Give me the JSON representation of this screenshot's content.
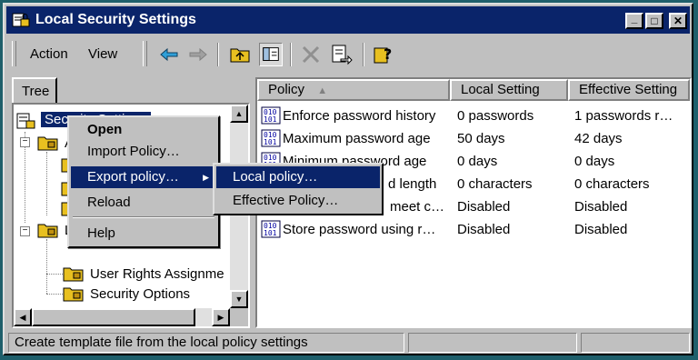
{
  "window": {
    "title": "Local Security Settings"
  },
  "caption_buttons": {
    "minimize": "_",
    "maximize": "□",
    "close": "✕"
  },
  "menu": {
    "action": "Action",
    "view": "View"
  },
  "tree": {
    "tab_label": "Tree",
    "root": "Security Settings",
    "items": [
      "A",
      "L",
      "User Rights Assignme",
      "Security Options"
    ]
  },
  "list": {
    "columns": [
      "Policy",
      "Local Setting",
      "Effective Setting"
    ],
    "sort_indicator": "▲",
    "rows": [
      {
        "policy": "Enforce password history",
        "local": "0 passwords",
        "effective": "1 passwords r…"
      },
      {
        "policy": "Maximum password age",
        "local": "50 days",
        "effective": "42 days"
      },
      {
        "policy": "Minimum password age",
        "local": "0 days",
        "effective": "0 days"
      },
      {
        "policy": "d length",
        "local": "0 characters",
        "effective": "0 characters"
      },
      {
        "policy": "meet c…",
        "local": "Disabled",
        "effective": "Disabled"
      },
      {
        "policy": "Store password using r…",
        "local": "Disabled",
        "effective": "Disabled"
      }
    ]
  },
  "context_menu": {
    "open": "Open",
    "import": "Import Policy…",
    "export": "Export policy…",
    "reload": "Reload",
    "help": "Help",
    "submenu_arrow": "▶"
  },
  "submenu": {
    "local": "Local policy…",
    "effective": "Effective Policy…"
  },
  "status": {
    "text": "Create template file from the local policy settings"
  },
  "colors": {
    "titlebar": "#0a246a",
    "face": "#c0c0c0",
    "desktop": "#1f5f6b",
    "highlight": "#0a246a"
  }
}
